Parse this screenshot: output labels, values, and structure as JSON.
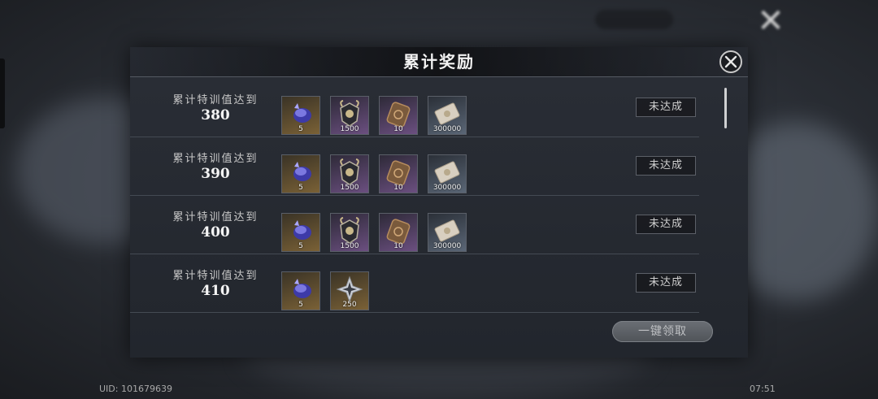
{
  "background": {
    "title": "",
    "close_glyph": "✕"
  },
  "modal": {
    "title": "累计奖励",
    "close_icon": "close-icon",
    "claim_all_label": "一键领取"
  },
  "rows": [
    {
      "label": "累计特训值达到",
      "value": "380",
      "status": "未达成",
      "items": [
        {
          "icon": "blue-gem-icon",
          "rarity": "gold",
          "count": "5"
        },
        {
          "icon": "horned-shield-icon",
          "rarity": "purple",
          "count": "1500"
        },
        {
          "icon": "bronze-token-icon",
          "rarity": "purple",
          "count": "10"
        },
        {
          "icon": "ticket-icon",
          "rarity": "blue",
          "count": "300000"
        }
      ]
    },
    {
      "label": "累计特训值达到",
      "value": "390",
      "status": "未达成",
      "items": [
        {
          "icon": "blue-gem-icon",
          "rarity": "gold",
          "count": "5"
        },
        {
          "icon": "horned-shield-icon",
          "rarity": "purple",
          "count": "1500"
        },
        {
          "icon": "bronze-token-icon",
          "rarity": "purple",
          "count": "10"
        },
        {
          "icon": "ticket-icon",
          "rarity": "blue",
          "count": "300000"
        }
      ]
    },
    {
      "label": "累计特训值达到",
      "value": "400",
      "status": "未达成",
      "items": [
        {
          "icon": "blue-gem-icon",
          "rarity": "gold",
          "count": "5"
        },
        {
          "icon": "horned-shield-icon",
          "rarity": "purple",
          "count": "1500"
        },
        {
          "icon": "bronze-token-icon",
          "rarity": "purple",
          "count": "10"
        },
        {
          "icon": "ticket-icon",
          "rarity": "blue",
          "count": "300000"
        }
      ]
    },
    {
      "label": "累计特训值达到",
      "value": "410",
      "status": "未达成",
      "items": [
        {
          "icon": "blue-gem-icon",
          "rarity": "gold",
          "count": "5"
        },
        {
          "icon": "silver-star-icon",
          "rarity": "gold",
          "count": "250"
        }
      ]
    }
  ],
  "footer": {
    "uid": "UID: 101679639",
    "clock": "07:51"
  },
  "colors": {
    "gold": "#7a6136",
    "purple": "#6b4f80",
    "blue": "#5a6676"
  }
}
